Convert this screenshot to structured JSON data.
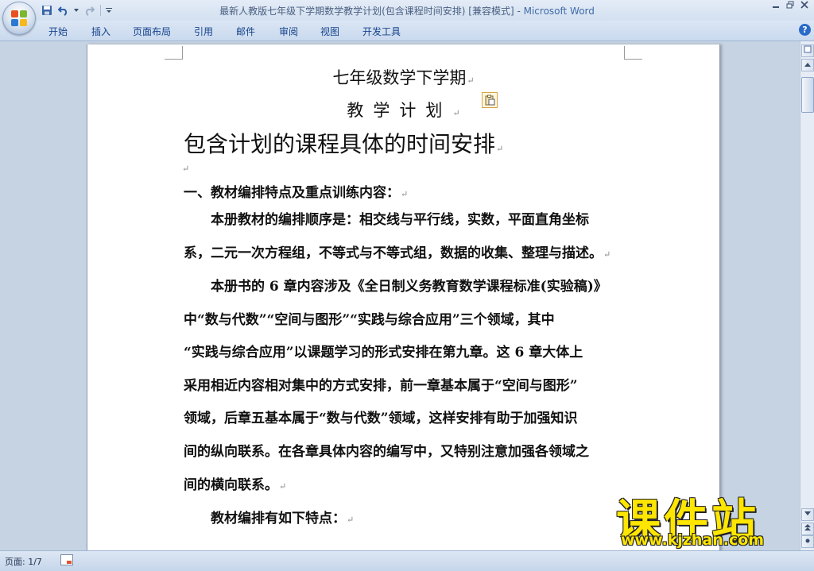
{
  "window": {
    "title": "最新人教版七年级下学期数学教学计划(包含课程时间安排) [兼容模式]",
    "app_name": "Microsoft Word",
    "separator": " - "
  },
  "ribbon": {
    "tabs": [
      "开始",
      "插入",
      "页面布局",
      "引用",
      "邮件",
      "审阅",
      "视图",
      "开发工具"
    ]
  },
  "document": {
    "title_line1": "七年级数学下学期",
    "title_line2": "教学计划",
    "subtitle": "包含计划的课程具体的时间安排",
    "section1_heading": "一、教材编排特点及重点训练内容：",
    "para1_lines": [
      "本册教材的编排顺序是：相交线与平行线，实数，平面直角坐标",
      "系，二元一次方程组，不等式与不等式组，数据的收集、整理与描述。"
    ],
    "para2_lines": [
      "本册书的 6 章内容涉及《全日制义务教育数学课程标准(实验稿)》",
      "中“数与代数”“空间与图形”“实践与综合应用”三个领域，其中",
      "“实践与综合应用”以课题学习的形式安排在第九章。这 6 章大体上",
      "采用相近内容相对集中的方式安排，前一章基本属于“空间与图形”",
      "领域，后章五基本属于“数与代数”领域，这样安排有助于加强知识",
      "间的纵向联系。在各章具体内容的编写中，又特别注意加强各领域之",
      "间的横向联系。"
    ],
    "para3": "教材编排有如下特点：",
    "paragraph_mark": "↵"
  },
  "statusbar": {
    "page_status": "页面: 1/7"
  },
  "watermark": {
    "brand": "课件站",
    "url": "www.kjzhan.com"
  },
  "colors": {
    "ribbon_text": "#15428b",
    "watermark": "#ffe600"
  }
}
